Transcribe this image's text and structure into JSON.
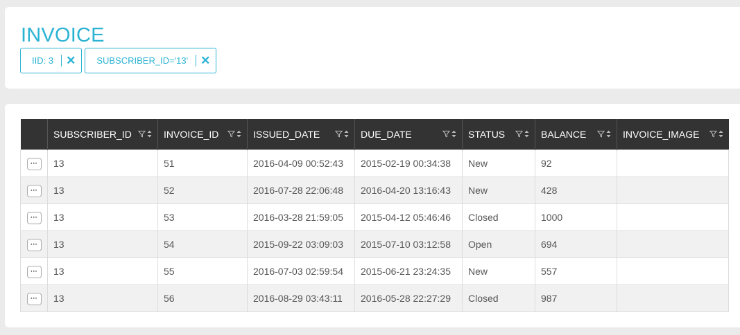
{
  "page": {
    "title": "INVOICE"
  },
  "filters": [
    {
      "label": "IID: 3"
    },
    {
      "label": "SUBSCRIBER_ID='13'"
    }
  ],
  "table": {
    "columns": [
      "SUBSCRIBER_ID",
      "INVOICE_ID",
      "ISSUED_DATE",
      "DUE_DATE",
      "STATUS",
      "BALANCE",
      "INVOICE_IMAGE"
    ],
    "row_action_label": "···",
    "rows": [
      [
        "13",
        "51",
        "2016-04-09 00:52:43",
        "2015-02-19 00:34:38",
        "New",
        "92",
        ""
      ],
      [
        "13",
        "52",
        "2016-07-28 22:06:48",
        "2016-04-20 13:16:43",
        "New",
        "428",
        ""
      ],
      [
        "13",
        "53",
        "2016-03-28 21:59:05",
        "2015-04-12 05:46:46",
        "Closed",
        "1000",
        ""
      ],
      [
        "13",
        "54",
        "2015-09-22 03:09:03",
        "2015-07-10 03:12:58",
        "Open",
        "694",
        ""
      ],
      [
        "13",
        "55",
        "2016-07-03 02:59:54",
        "2015-06-21 23:24:35",
        "New",
        "557",
        ""
      ],
      [
        "13",
        "56",
        "2016-08-29 03:43:11",
        "2016-05-28 22:27:29",
        "Closed",
        "987",
        ""
      ]
    ]
  },
  "colors": {
    "accent": "#2bb3d4",
    "header_bg": "#333333",
    "page_bg": "#ebebeb"
  },
  "icons": {
    "filter": "funnel-icon",
    "sort": "sort-icon",
    "remove": "close-icon"
  }
}
